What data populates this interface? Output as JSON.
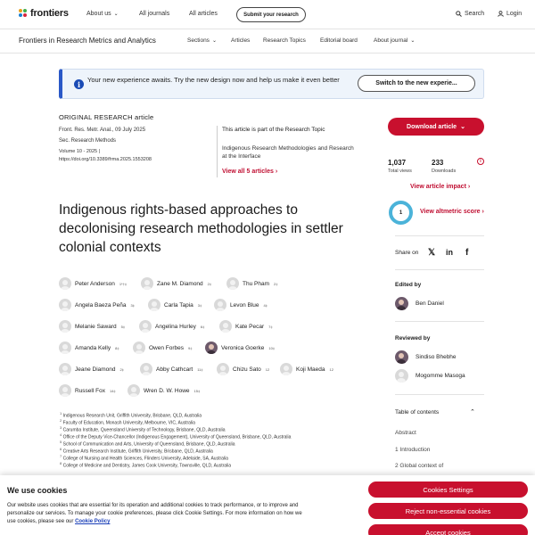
{
  "header": {
    "logo_text": "frontiers",
    "nav": [
      "About us",
      "All journals",
      "All articles"
    ],
    "submit_label": "Submit your research",
    "search_label": "Search",
    "login_label": "Login"
  },
  "subheader": {
    "journal": "Frontiers in Research Metrics and Analytics",
    "nav": [
      "Sections",
      "Articles",
      "Research Topics",
      "Editorial board",
      "About journal"
    ]
  },
  "banner": {
    "text": "Your new experience awaits. Try the new design now and help us make it even better",
    "button": "Switch to the new experie..."
  },
  "article": {
    "type": "ORIGINAL RESEARCH article",
    "citation": "Front. Res. Metr. Anal., 09 July 2025",
    "section": "Sec. Research Methods",
    "volume": "Volume 10 - 2025 |",
    "doi": "https://doi.org/10.3389/frma.2025.1553208",
    "part_of_label": "This article is part of the Research Topic",
    "topic": "Indigenous Research Methodologies and Research at the Interface",
    "view_all": "View all 5 articles",
    "title": "Indigenous rights-based approaches to decolonising research methodologies in settler colonial contexts"
  },
  "authors": [
    {
      "name": "Peter Anderson",
      "sup": "1*†‡"
    },
    {
      "name": "Zane M. Diamond",
      "sup": "2‡"
    },
    {
      "name": "Thu Pham",
      "sup": "2‡"
    },
    {
      "name": "Angela Baeza Peña",
      "sup": "3‡"
    },
    {
      "name": "Carla Tapia",
      "sup": "3‡"
    },
    {
      "name": "Levon Blue",
      "sup": "4‡"
    },
    {
      "name": "Melanie Saward",
      "sup": "5‡"
    },
    {
      "name": "Angelina Hurley",
      "sup": "6‡"
    },
    {
      "name": "Kate Pecar",
      "sup": "7‡"
    },
    {
      "name": "Amanda Kelly",
      "sup": "8‡"
    },
    {
      "name": "Owen Forbes",
      "sup": "9‡"
    },
    {
      "name": "Veronica Goerke",
      "sup": "10‡"
    },
    {
      "name": "Jeane Diamond",
      "sup": "2‡"
    },
    {
      "name": "Abby Cathcart",
      "sup": "11‡"
    },
    {
      "name": "Chizu Sato",
      "sup": "12"
    },
    {
      "name": "Koji Maeda",
      "sup": "12"
    },
    {
      "name": "Russell Fox",
      "sup": "14‡"
    },
    {
      "name": "Wren D. W. Howe",
      "sup": "15‡"
    }
  ],
  "affiliations": [
    {
      "num": "1",
      "text": "Indigenous Research Unit, Griffith University, Brisbane, QLD, Australia"
    },
    {
      "num": "2",
      "text": "Faculty of Education, Monash University, Melbourne, VIC, Australia"
    },
    {
      "num": "3",
      "text": "Carumba Institute, Queensland University of Technology, Brisbane, QLD, Australia"
    },
    {
      "num": "4",
      "text": "Office of the Deputy Vice-Chancellor (Indigenous Engagement), University of Queensland, Brisbane, QLD, Australia"
    },
    {
      "num": "5",
      "text": "School of Communication and Arts, University of Queensland, Brisbane, QLD, Australia"
    },
    {
      "num": "6",
      "text": "Creative Arts Research Institute, Griffith University, Brisbane, QLD, Australia"
    },
    {
      "num": "7",
      "text": "College of Nursing and Health Sciences, Flinders University, Adelaide, SA, Australia"
    },
    {
      "num": "8",
      "text": "College of Medicine and Dentistry, James Cook University, Townsville, QLD, Australia"
    }
  ],
  "sidebar": {
    "download": "Download article",
    "views_num": "1,037",
    "views_label": "Total views",
    "downloads_num": "233",
    "downloads_label": "Downloads",
    "impact_link": "View article impact",
    "altmetric_score": "1",
    "altmetric_link": "View altmetric score",
    "share_label": "Share on",
    "edited_by": "Edited by",
    "editor": "Ben Daniel",
    "reviewed_by": "Reviewed by",
    "reviewers": [
      "Sindiso Bhebhe",
      "Mogomme Masoga"
    ],
    "toc_title": "Table of contents",
    "toc": [
      "Abstract",
      "1 Introduction",
      "2 Global context of"
    ]
  },
  "cookie": {
    "title": "We use cookies",
    "text": "Our website uses cookies that are essential for its operation and additional cookies to track performance, or to improve and personalize our services. To manage your cookie preferences, please click Cookie Settings. For more information on how we use cookies, please see our",
    "link": "Cookie Policy",
    "settings": "Cookies Settings",
    "reject": "Reject non-essential cookies",
    "accept": "Accept cookies"
  },
  "colors": {
    "brand_red": "#c8102e",
    "banner_blue": "#2a58c7",
    "altmetric_blue": "#4bb3d9"
  }
}
